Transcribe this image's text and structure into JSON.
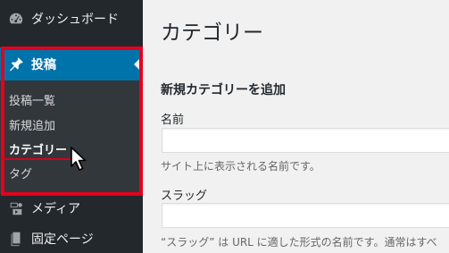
{
  "sidebar": {
    "items": [
      {
        "label": "ダッシュボード",
        "icon": "dashboard-icon"
      },
      {
        "label": "投稿",
        "icon": "pin-icon",
        "active": true
      },
      {
        "label": "メディア",
        "icon": "media-icon"
      },
      {
        "label": "固定ページ",
        "icon": "pages-icon"
      }
    ],
    "submenu": [
      {
        "label": "投稿一覧"
      },
      {
        "label": "新規追加"
      },
      {
        "label": "カテゴリー",
        "current": true
      },
      {
        "label": "タグ"
      }
    ]
  },
  "content": {
    "page_title": "カテゴリー",
    "section_title": "新規カテゴリーを追加",
    "name_label": "名前",
    "name_value": "",
    "name_description": "サイト上に表示される名前です。",
    "slug_label": "スラッグ",
    "slug_value": "",
    "slug_description": "“スラッグ” は URL に適した形式の名前です。通常はすべ"
  },
  "colors": {
    "sidebar_bg": "#23282d",
    "submenu_bg": "#32373c",
    "active_bg": "#0073aa",
    "highlight_border": "#e5001c",
    "content_bg": "#f1f1f1"
  }
}
